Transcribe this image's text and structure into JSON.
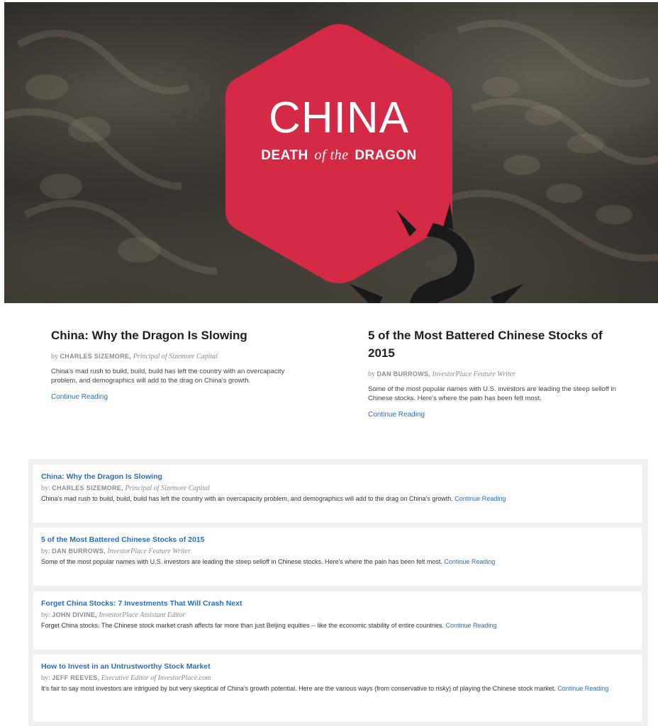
{
  "hero": {
    "title": "CHINA",
    "subtitle_part1": "DEATH",
    "subtitle_part2": "of the",
    "subtitle_part3": "DRAGON",
    "badge_color": "#d42a46",
    "icon": "dragon-icon"
  },
  "features": [
    {
      "title": "China: Why the Dragon Is Slowing",
      "byline_prefix": "by",
      "author": "CHARLES SIZEMORE,",
      "role": "Principal of Sizemore Capital",
      "description": "China's mad rush to build, build, build has left the country with an overcapacity problem, and demographics will add to the drag on China's growth.",
      "link": "Continue Reading"
    },
    {
      "title": "5 of the Most Battered Chinese Stocks of 2015",
      "byline_prefix": "by",
      "author": "DAN BURROWS,",
      "role": "InvestorPlace Feature Writer",
      "description": "Some of the most popular names with U.S. investors are leading the steep selloff in Chinese stocks. Here's where the pain has been felt most.",
      "link": "Continue Reading"
    }
  ],
  "list": [
    {
      "title": "China: Why the Dragon Is Slowing",
      "byline_prefix": "by:",
      "author": "CHARLES SIZEMORE,",
      "role": "Principal of Sizemore Capital",
      "description": "China's mad rush to build, build, build has left the country with an overcapacity problem, and demographics will add to the drag on China's growth.",
      "link": "Continue Reading"
    },
    {
      "title": "5 of the Most Battered Chinese Stocks of 2015",
      "byline_prefix": "by:",
      "author": "DAN BURROWS,",
      "role": "InvestorPlace Feature Writer",
      "description": "Some of the most popular names with U.S. investors are leading the steep selloff in Chinese stocks. Here's where the pain has been felt most.",
      "link": "Continue Reading"
    },
    {
      "title": "Forget China Stocks: 7 Investments That Will Crash Next",
      "byline_prefix": "by:",
      "author": "JOHN DIVINE,",
      "role": "InvestorPlace Assistant Editor",
      "description": "Forget China stocks. The Chinese stock market crash affects far more than just Beijing equities -- like the economic stability of entire countries.",
      "link": "Continue Reading"
    },
    {
      "title": "How to Invest in an Untrustworthy Stock Market",
      "byline_prefix": "by:",
      "author": "JEFF REEVES,",
      "role": "Executive Editor of InvestorPlace.com",
      "description": "It's fair to say most investors are intrigued by but very skeptical of China's growth potential. Here are the various ways (from conservative to risky) of playing the Chinese stock market.",
      "link": "Continue Reading"
    }
  ]
}
